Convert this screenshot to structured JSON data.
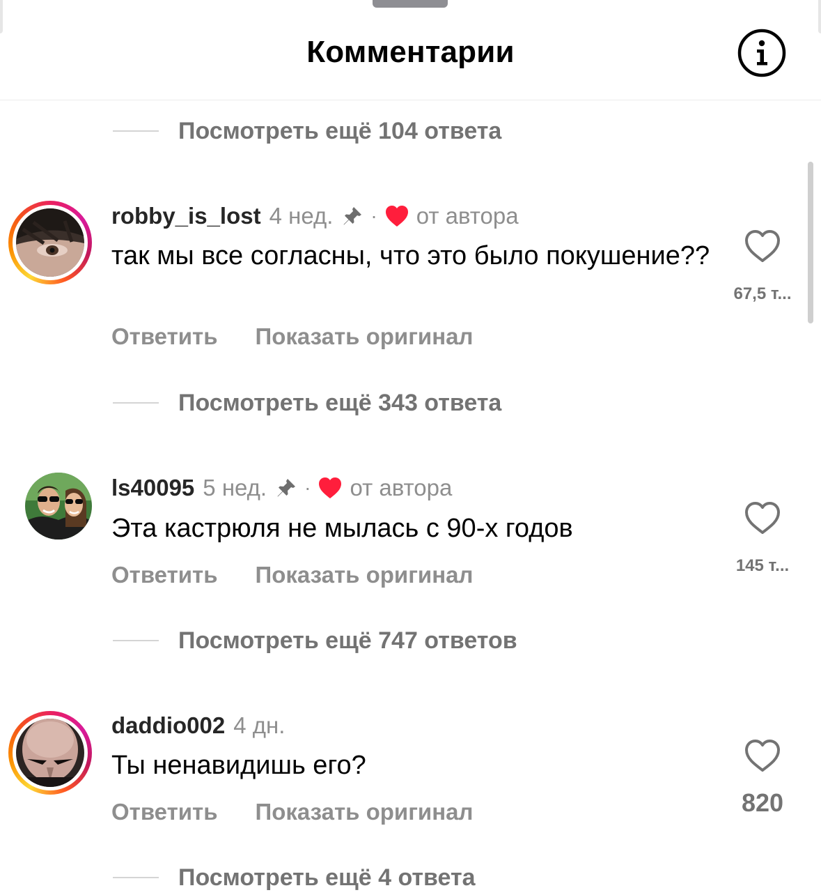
{
  "header": {
    "title": "Комментарии"
  },
  "icons": {
    "info": "info-circle-icon",
    "pin": "pin-icon",
    "creator_heart": "heart-filled-icon",
    "like": "heart-outline-icon"
  },
  "colors": {
    "creator_heart": "#ff1e3c",
    "secondary_text": "#8e8e8e",
    "replies_text": "#737373"
  },
  "top_replies": {
    "label": "Посмотреть ещё 104 ответа"
  },
  "comments": [
    {
      "username": "robby_is_lost",
      "time": "4 нед.",
      "pinned": true,
      "liked_by_author": true,
      "separator": "·",
      "author_label": "от автора",
      "text": "так мы все согласны, что это было покушение??",
      "reply_label": "Ответить",
      "show_original_label": "Показать оригинал",
      "like_count": "67,5 т...",
      "more_replies": "Посмотреть ещё 343 ответа"
    },
    {
      "username": "ls40095",
      "time": "5 нед.",
      "pinned": true,
      "liked_by_author": true,
      "separator": "·",
      "author_label": "от автора",
      "text": "Эта кастрюля не мылась с 90-х годов",
      "reply_label": "Ответить",
      "show_original_label": "Показать оригинал",
      "like_count": "145 т...",
      "more_replies": "Посмотреть ещё 747 ответов"
    },
    {
      "username": "daddio002",
      "time": "4 дн.",
      "pinned": false,
      "liked_by_author": false,
      "text": "Ты ненавидишь его?",
      "reply_label": "Ответить",
      "show_original_label": "Показать оригинал",
      "like_count": "820",
      "more_replies": "Посмотреть ещё 4 ответа"
    }
  ]
}
